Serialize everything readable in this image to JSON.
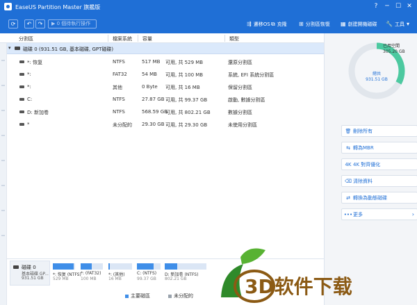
{
  "window": {
    "title": "EaseUS Partition Master 旗艦版",
    "controls": [
      "?",
      "─",
      "☐",
      "✕"
    ]
  },
  "toolbar": {
    "undo_icon": "↶",
    "redo_icon": "↷",
    "pending_label": "▶ 0 個待執行操作",
    "migrate_os": "遷移OS",
    "clone": "克隆",
    "partition_recovery": "分割區恢復",
    "create_bootable": "創建開機磁碟",
    "tools": "工具"
  },
  "columns": {
    "partition": "分割區",
    "filesystem": "檔案系統",
    "capacity": "容量",
    "type": "類型"
  },
  "disk": {
    "label": "磁碟 0 (931.51 GB, 基本磁碟, GPT磁碟)"
  },
  "partitions": [
    {
      "name": "*: 恢复",
      "fs": "NTFS",
      "used": "517 MB",
      "total": "可用, 共  529 MB",
      "type": "還原分割區"
    },
    {
      "name": "*:",
      "fs": "FAT32",
      "used": "54 MB",
      "total": "可用, 共  100 MB",
      "type": "系統, EFI 系統分割區"
    },
    {
      "name": "*:",
      "fs": "其他",
      "used": "0 Byte",
      "total": "可用, 共  16 MB",
      "type": "保留分割區"
    },
    {
      "name": "C:",
      "fs": "NTFS",
      "used": "27.87 GB",
      "total": "可用, 共  99.37 GB",
      "type": "啟動, 數據分割區"
    },
    {
      "name": "D: 新加卷",
      "fs": "NTFS",
      "used": "568.59 GB",
      "total": "可用, 共  802.21 GB",
      "type": "數據分割區"
    },
    {
      "name": "*",
      "fs": "未分配的",
      "used": "29.30 GB",
      "total": "可用, 共  29.30 GB",
      "type": "未使用分割區"
    }
  ],
  "usage": {
    "used_title": "已用空間",
    "used_value": "305.20 GB",
    "total_title": "總共",
    "total_value": "931.51 GB",
    "used_fraction": 0.33
  },
  "actions": [
    {
      "icon": "🗑",
      "label": "刪除所有"
    },
    {
      "icon": "⇆",
      "label": "轉為MBR"
    },
    {
      "icon": "4K",
      "label": "4K 對齊優化"
    },
    {
      "icon": "⌫",
      "label": "清除資料"
    },
    {
      "icon": "⇄",
      "label": "轉換為動態磁碟"
    },
    {
      "icon": "•••",
      "label": "更多",
      "arrow": "›"
    }
  ],
  "bottom": {
    "disk_name": "磁碟 0",
    "disk_type": "基本磁碟 GP...",
    "disk_size": "931.51 GB",
    "segments": [
      {
        "name": "*: 恢复 (NTFS)",
        "size": "529 MB",
        "used": 0.95
      },
      {
        "name": "*: (FAT32)",
        "size": "100 MB",
        "used": 0.5
      },
      {
        "name": "*: (其他)",
        "size": "16 MB",
        "used": 0.05
      },
      {
        "name": "C: (NTFS)",
        "size": "99.37 GB",
        "used": 0.72
      },
      {
        "name": "D: 新加卷 (NTFS)",
        "size": "802.21 GB",
        "used": 0.3
      }
    ],
    "legend": [
      {
        "label": "主要磁區",
        "color": "#3f8ee8"
      },
      {
        "label": "未分配的",
        "color": "#9aa3ad"
      }
    ]
  },
  "watermark": {
    "text": "3D软件下载"
  },
  "colors": {
    "accent": "#1f6fd6",
    "donut": "#4cc9a0",
    "selection": "#dbe9fb"
  }
}
